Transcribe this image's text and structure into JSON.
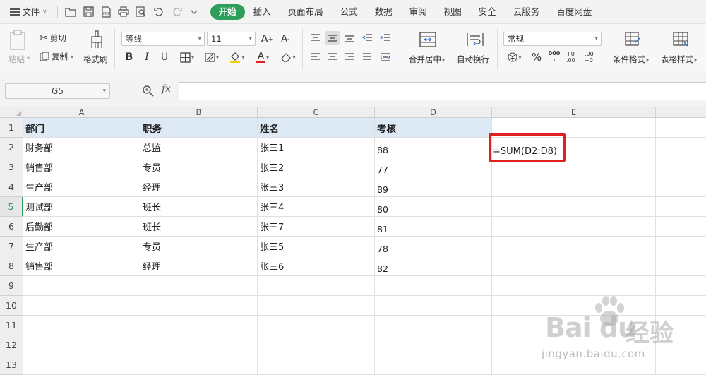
{
  "menubar": {
    "file_label": "文件",
    "tabs": [
      "开始",
      "插入",
      "页面布局",
      "公式",
      "数据",
      "审阅",
      "视图",
      "安全",
      "云服务",
      "百度网盘"
    ],
    "active_tab": "开始",
    "accent_color": "#2e9f5a"
  },
  "ribbon": {
    "paste": "粘贴",
    "cut": "剪切",
    "copy": "复制",
    "format_painter": "格式刷",
    "font_name": "等线",
    "font_size": "11",
    "bold": "B",
    "italic": "I",
    "underline": "U",
    "font_color_glyph": "A",
    "merge_center": "合并居中",
    "wrap_text": "自动换行",
    "number_format": "常规",
    "percent": "%",
    "thousands": "000",
    "inc_decimal": "+0 .00",
    "dec_decimal": ".00 +0",
    "conditional_format": "条件格式",
    "table_style": "表格样式"
  },
  "formula_bar": {
    "name_box": "G5",
    "fx": "fx",
    "content": ""
  },
  "sheet": {
    "columns": [
      "A",
      "B",
      "C",
      "D",
      "E"
    ],
    "rows": [
      "1",
      "2",
      "3",
      "4",
      "5",
      "6",
      "7",
      "8",
      "9",
      "10",
      "11",
      "12",
      "13"
    ],
    "active_row": "5",
    "header": [
      "部门",
      "职务",
      "姓名",
      "考核"
    ],
    "data": [
      [
        "财务部",
        "总监",
        "张三1",
        "88"
      ],
      [
        "销售部",
        "专员",
        "张三2",
        "77"
      ],
      [
        "生产部",
        "经理",
        "张三3",
        "89"
      ],
      [
        "测试部",
        "班长",
        "张三4",
        "80"
      ],
      [
        "后勤部",
        "班长",
        "张三7",
        "81"
      ],
      [
        "生产部",
        "专员",
        "张三5",
        "78"
      ],
      [
        "销售部",
        "经理",
        "张三6",
        "82"
      ]
    ],
    "formula_text": "=SUM(D2:D8)",
    "highlight_color": "#e02020",
    "header_fill": "#dde9f5"
  },
  "watermark": {
    "logo": "Bai du",
    "site": "经验",
    "url": "jingyan.baidu.com"
  }
}
